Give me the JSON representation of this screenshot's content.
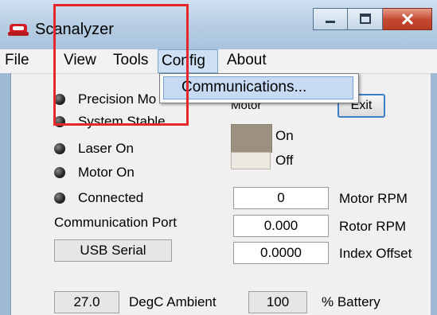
{
  "window": {
    "title": "Scanalyzer",
    "brand_color": "#d11f24"
  },
  "window_buttons": [
    {
      "name": "minimize-icon"
    },
    {
      "name": "maximize-icon"
    },
    {
      "name": "close-icon"
    }
  ],
  "menu": {
    "file": "File",
    "view": "View",
    "tools": "Tools",
    "config": "Config",
    "about": "About"
  },
  "dropdown": {
    "item": "Communications..."
  },
  "indicators": {
    "precision": "Precision Mo",
    "stable": "System Stable",
    "laser": "Laser On",
    "motor": "Motor On",
    "connected": "Connected"
  },
  "motor_group": {
    "title": "Motor",
    "on_label": "On",
    "off_label": "Off",
    "state": "On"
  },
  "exit_label": "Exit",
  "readouts": {
    "motor_rpm": {
      "value": "0",
      "label": "Motor RPM"
    },
    "rotor_rpm": {
      "value": "0.000",
      "label": "Rotor RPM"
    },
    "index_offset": {
      "value": "0.0000",
      "label": "Index Offset"
    }
  },
  "comm": {
    "label": "Communication Port",
    "value": "USB Serial"
  },
  "ambient": {
    "value": "27.0",
    "label": "DegC Ambient"
  },
  "battery": {
    "value": "100",
    "label": "% Battery"
  },
  "annotation_color": "#e5262b"
}
